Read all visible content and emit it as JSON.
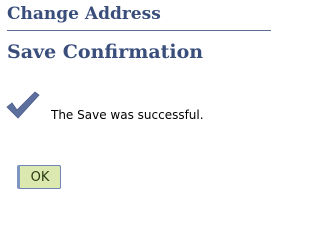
{
  "header": {
    "title": "Change Address"
  },
  "page": {
    "title": "Save Confirmation"
  },
  "confirmation": {
    "icon": "checkmark-icon",
    "message": "The Save was successful."
  },
  "actions": {
    "ok_label": "OK"
  },
  "colors": {
    "heading": "#3a4e7c",
    "header_rule": "#5a6d92",
    "checkmark": "#5c6f9e",
    "button_bg": "#dbe9b0"
  }
}
